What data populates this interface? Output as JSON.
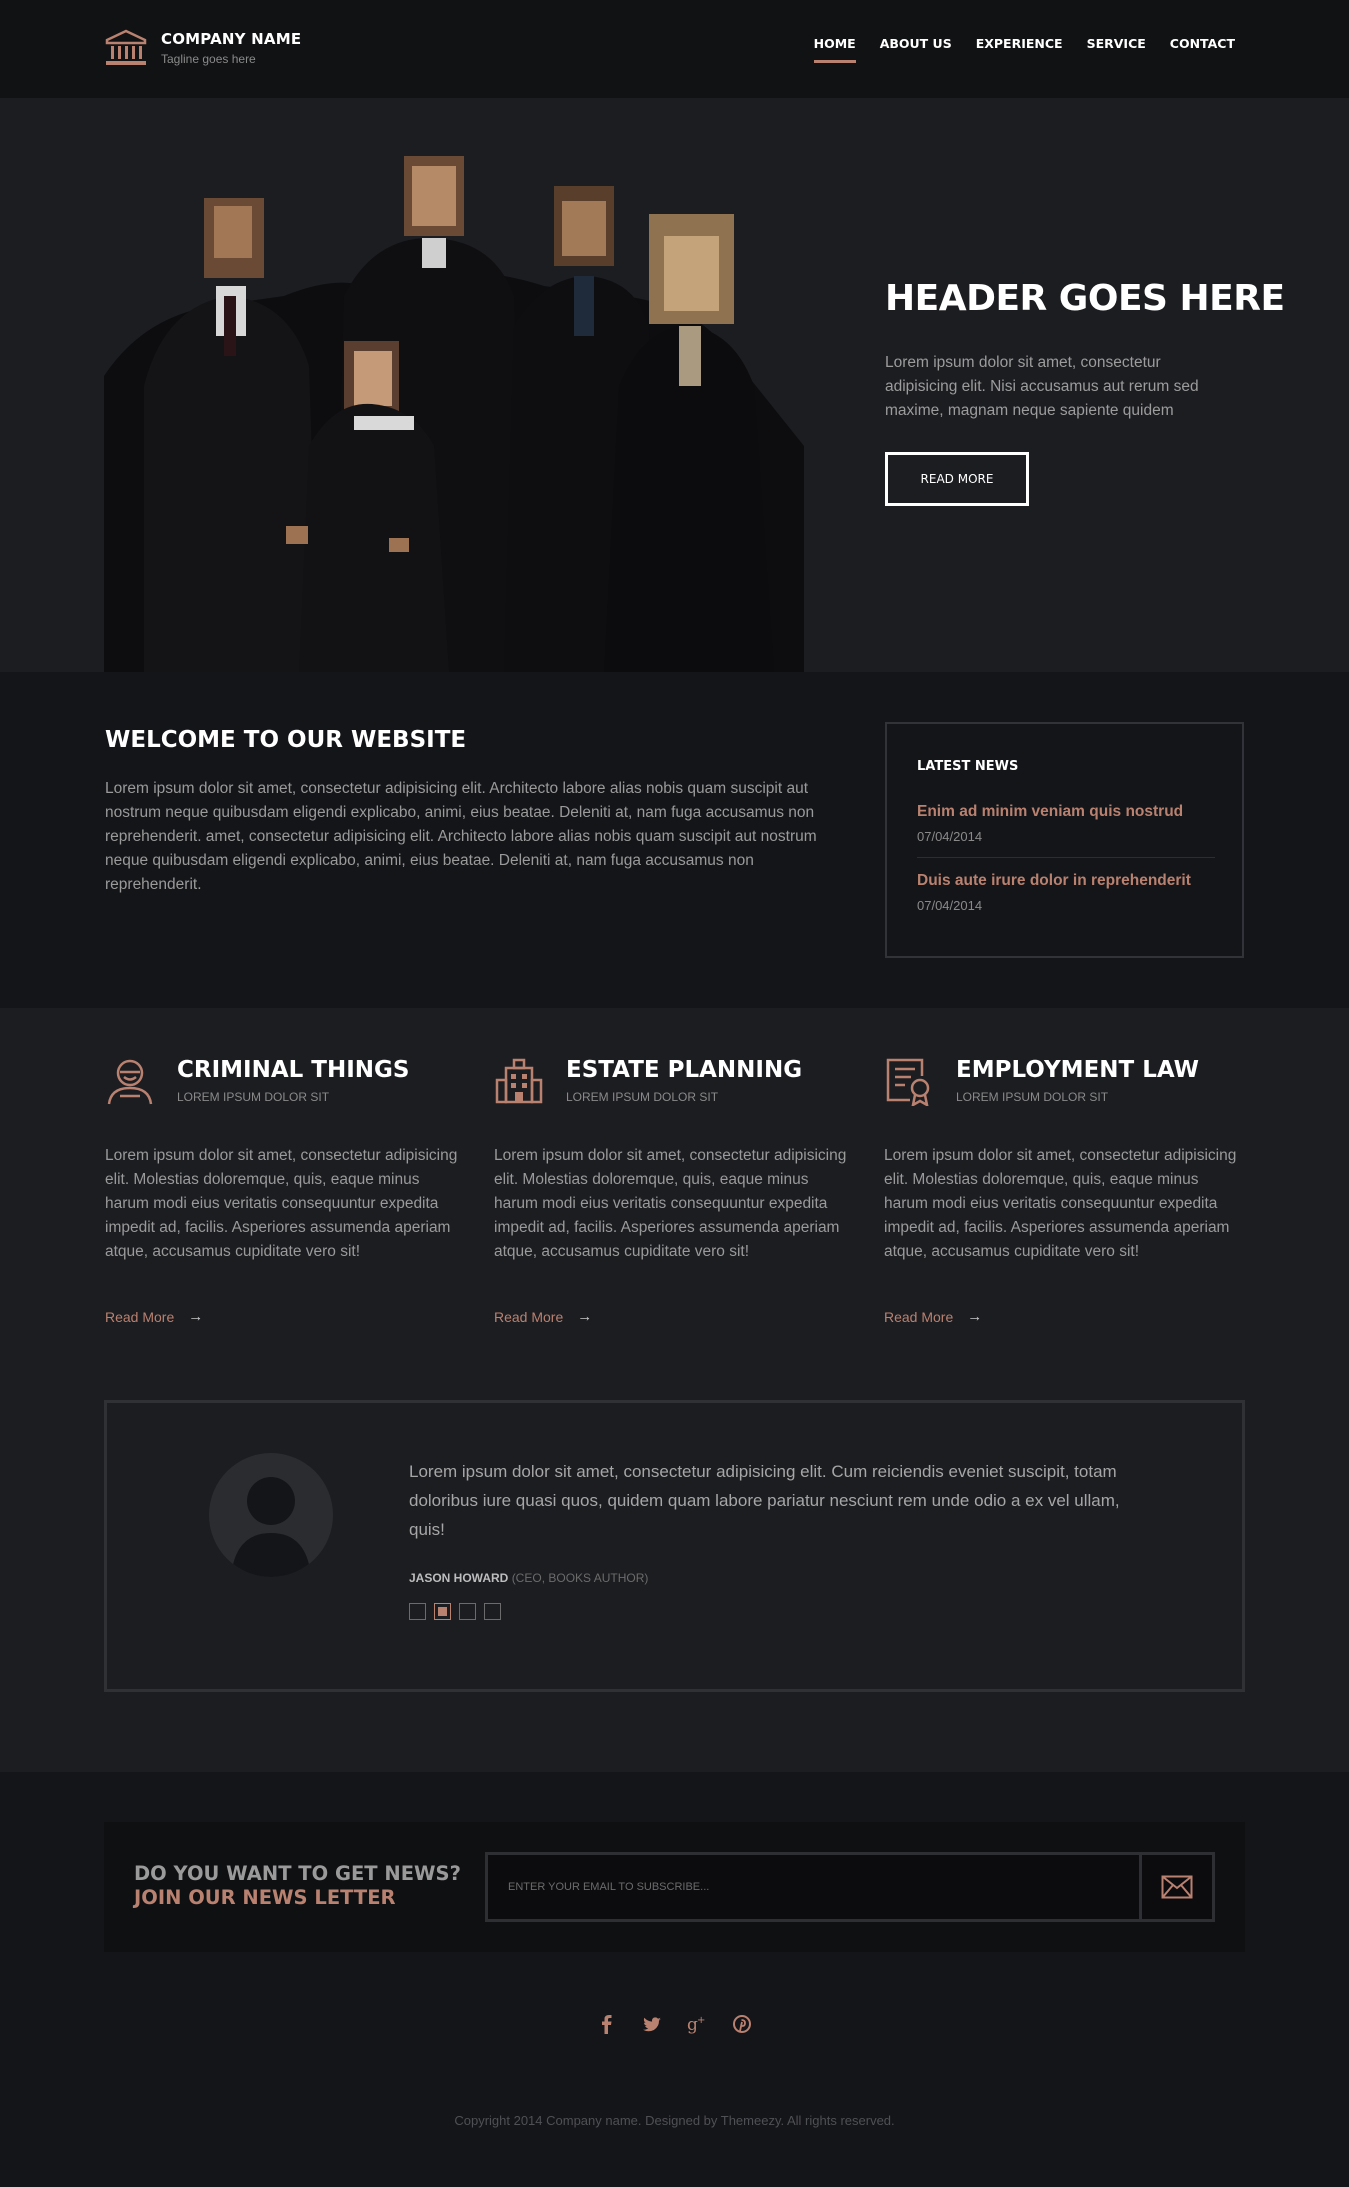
{
  "brand": {
    "name": "COMPANY NAME",
    "tagline": "Tagline goes here"
  },
  "nav": [
    {
      "label": "HOME",
      "active": true
    },
    {
      "label": "ABOUT US",
      "active": false
    },
    {
      "label": "EXPERIENCE",
      "active": false
    },
    {
      "label": "SERVICE",
      "active": false
    },
    {
      "label": "CONTACT",
      "active": false
    }
  ],
  "hero": {
    "title": "HEADER GOES HERE",
    "text": "Lorem ipsum dolor sit amet, consectetur adipisicing elit. Nisi accusamus aut rerum sed maxime, magnam neque sapiente quidem",
    "button": "READ MORE"
  },
  "welcome": {
    "title": "WELCOME TO OUR WEBSITE",
    "text": "Lorem ipsum dolor sit amet, consectetur adipisicing elit. Architecto labore alias nobis quam suscipit aut nostrum neque quibusdam eligendi explicabo, animi, eius beatae. Deleniti at, nam fuga accusamus non reprehenderit. amet, consectetur adipisicing elit. Architecto labore alias nobis quam suscipit aut nostrum neque quibusdam eligendi explicabo, animi, eius beatae. Deleniti at, nam fuga accusamus non reprehenderit."
  },
  "news": {
    "heading": "LATEST NEWS",
    "items": [
      {
        "title": "Enim ad minim veniam quis nostrud",
        "date": "07/04/2014"
      },
      {
        "title": "Duis aute irure dolor in reprehenderit",
        "date": "07/04/2014"
      }
    ]
  },
  "services": [
    {
      "icon": "criminal-icon",
      "title": "CRIMINAL THINGS",
      "subtitle": "LOREM IPSUM DOLOR SIT",
      "text": "Lorem ipsum dolor sit amet, consectetur adipisicing elit. Molestias doloremque, quis, eaque minus harum modi eius veritatis consequuntur expedita impedit ad, facilis. Asperiores assumenda aperiam atque, accusamus cupiditate vero sit!",
      "link": "Read More"
    },
    {
      "icon": "building-icon",
      "title": "ESTATE PLANNING",
      "subtitle": "LOREM IPSUM DOLOR SIT",
      "text": "Lorem ipsum dolor sit amet, consectetur adipisicing elit. Molestias doloremque, quis, eaque minus harum modi eius veritatis consequuntur expedita impedit ad, facilis. Asperiores assumenda aperiam atque, accusamus cupiditate vero sit!",
      "link": "Read More"
    },
    {
      "icon": "certificate-icon",
      "title": "EMPLOYMENT LAW",
      "subtitle": "LOREM IPSUM DOLOR SIT",
      "text": "Lorem ipsum dolor sit amet, consectetur adipisicing elit. Molestias doloremque, quis, eaque minus harum modi eius veritatis consequuntur expedita impedit ad, facilis. Asperiores assumenda aperiam atque, accusamus cupiditate vero sit!",
      "link": "Read More"
    }
  ],
  "testimonial": {
    "quote": "Lorem ipsum dolor sit amet, consectetur adipisicing elit. Cum reiciendis eveniet suscipit, totam doloribus iure quasi quos, quidem quam labore pariatur nesciunt rem unde odio a ex vel ullam, quis!",
    "name": "JASON HOWARD",
    "role": "(CEO, BOOKS AUTHOR)",
    "slides": 4,
    "active_slide": 2
  },
  "newsletter": {
    "line1": "DO YOU WANT TO GET NEWS?",
    "line2": "JOIN OUR NEWS LETTER",
    "placeholder": "ENTER YOUR EMAIL TO SUBSCRIBE..."
  },
  "social": [
    "facebook-icon",
    "twitter-icon",
    "google-plus-icon",
    "pinterest-icon"
  ],
  "copyright": "Copyright 2014 Company name. Designed by Themeezy. All rights reserved.",
  "colors": {
    "accent": "#b98170",
    "background": "#1a1b1e",
    "header": "#111214"
  }
}
